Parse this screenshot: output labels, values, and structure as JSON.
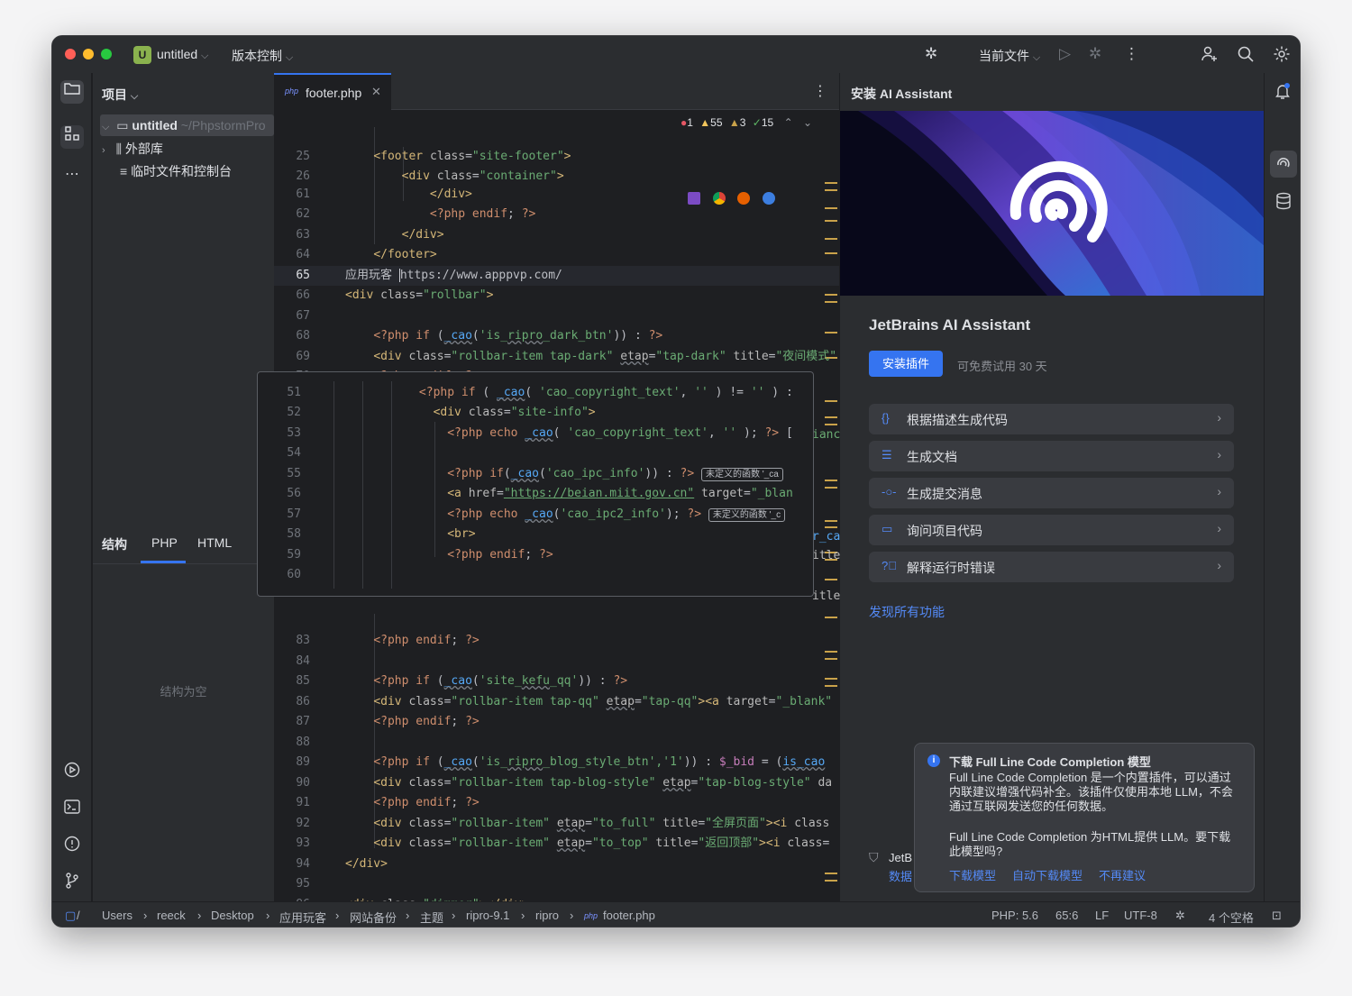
{
  "titlebar": {
    "project_badge": "U",
    "project_name": "untitled",
    "vcs_label": "版本控制",
    "run_config": "当前文件",
    "traffic_colors": [
      "#ff5f57",
      "#febc2e",
      "#28c840"
    ]
  },
  "project_panel": {
    "title": "项目",
    "tree": [
      {
        "label": "untitled",
        "hint": "~/PhpstormPro"
      },
      {
        "label": "外部库"
      },
      {
        "label": "临时文件和控制台"
      }
    ]
  },
  "structure": {
    "tabs": [
      "结构",
      "PHP",
      "HTML"
    ],
    "empty_text": "结构为空"
  },
  "editor": {
    "tab_label": "footer.php",
    "php_badge": "php",
    "inspections": {
      "errors": "1",
      "warnings": "55",
      "weak_warnings": "3",
      "ok": "15"
    }
  },
  "ai_panel": {
    "header": "安装 AI Assistant",
    "title": "JetBrains AI Assistant",
    "install_button": "安装插件",
    "trial_text": "可免费试用 30 天",
    "items": [
      {
        "icon": "braces-icon",
        "label": "根据描述生成代码"
      },
      {
        "icon": "doc-icon",
        "label": "生成文档"
      },
      {
        "icon": "commit-icon",
        "label": "生成提交消息"
      },
      {
        "icon": "chat-icon",
        "label": "询问项目代码"
      },
      {
        "icon": "question-icon",
        "label": "解释运行时错误"
      }
    ],
    "discover_link": "发现所有功能",
    "footer_text1": "JetB",
    "footer_text2": "数据"
  },
  "notification": {
    "title": "下载 Full Line Code Completion 模型",
    "body1": "Full Line Code Completion 是一个内置插件，可以通过内联建议增强代码补全。该插件仅使用本地 LLM，不会通过互联网发送您的任何数据。",
    "body2": "Full Line Code Completion 为HTML提供 LLM。要下载此模型吗?",
    "actions": [
      "下载模型",
      "自动下载模型",
      "不再建议"
    ]
  },
  "statusbar": {
    "breadcrumbs": [
      "Users",
      "reeck",
      "Desktop",
      "应用玩客",
      "网站备份",
      "主题",
      "ripro-9.1",
      "ripro",
      "footer.php"
    ],
    "php_version": "PHP: 5.6",
    "position": "65:6",
    "line_sep": "LF",
    "encoding": "UTF-8",
    "indent": "4 个空格"
  }
}
